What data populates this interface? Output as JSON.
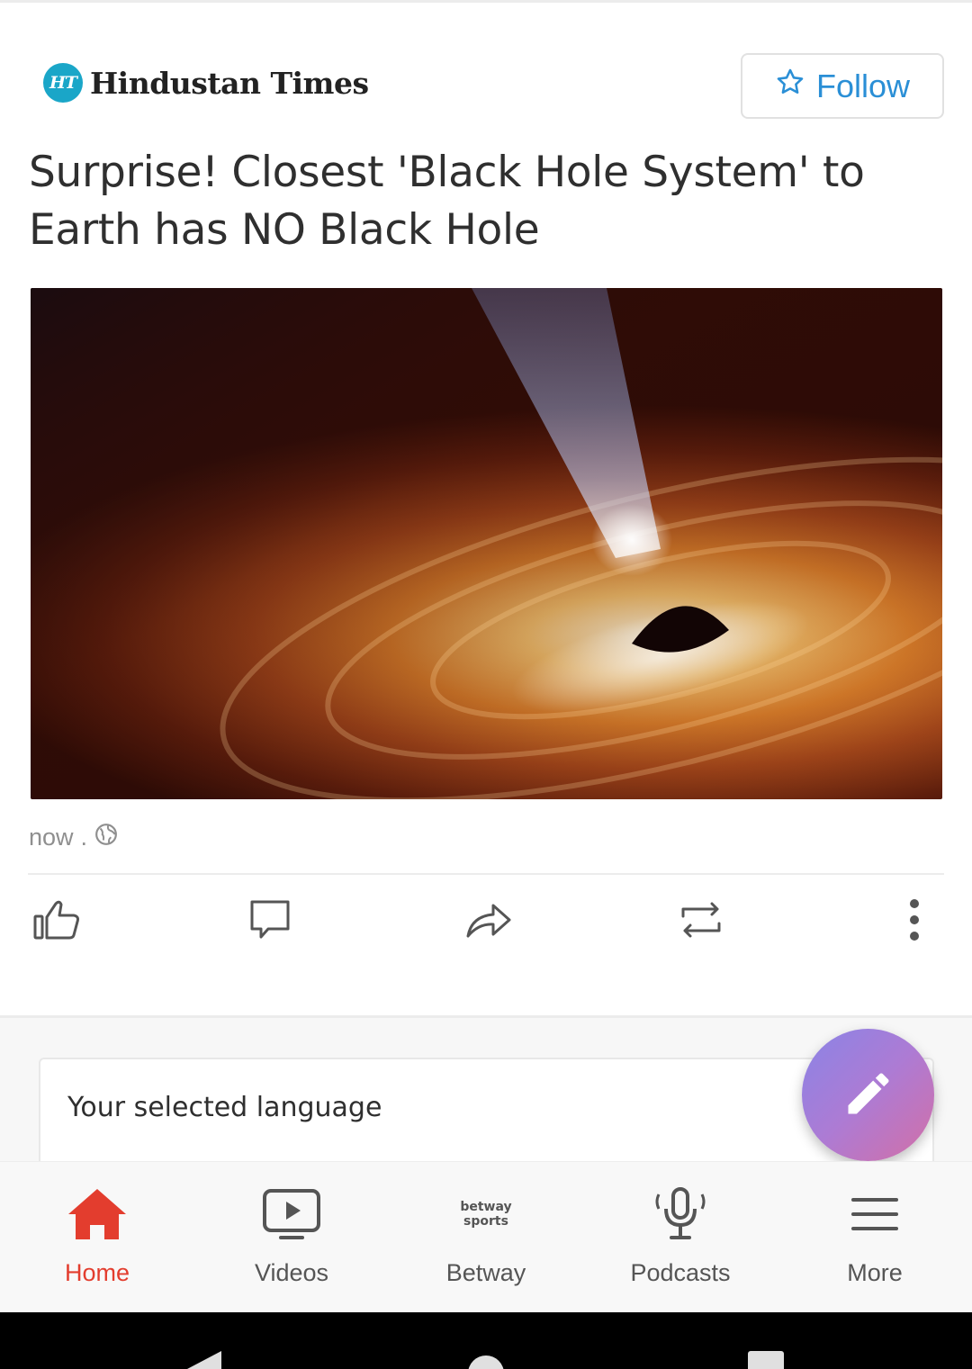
{
  "publisher": {
    "badge": "HT",
    "name": "Hindustan Times",
    "follow_label": "Follow"
  },
  "article": {
    "title": "Surprise! Closest 'Black Hole System' to Earth has NO Black Hole",
    "time": "now",
    "separator": ".",
    "visibility_icon": "globe-icon"
  },
  "actions": [
    {
      "name": "like",
      "icon": "thumbs-up-icon"
    },
    {
      "name": "comment",
      "icon": "comment-icon"
    },
    {
      "name": "share",
      "icon": "share-icon"
    },
    {
      "name": "repost",
      "icon": "repost-icon"
    },
    {
      "name": "more",
      "icon": "more-vertical-icon"
    }
  ],
  "language_card": {
    "label": "Your selected language"
  },
  "fab": {
    "icon": "pencil-icon"
  },
  "bottom_nav": {
    "items": [
      {
        "label": "Home",
        "icon": "home-icon",
        "active": true
      },
      {
        "label": "Videos",
        "icon": "video-icon",
        "active": false
      },
      {
        "label": "Betway",
        "icon": "betway-sports-logo",
        "logo_text": "betway sports",
        "active": false
      },
      {
        "label": "Podcasts",
        "icon": "microphone-icon",
        "active": false
      },
      {
        "label": "More",
        "icon": "menu-icon",
        "active": false
      }
    ]
  },
  "colors": {
    "accent_blue": "#2a8fd6",
    "active_red": "#e33d2e",
    "icon_gray": "#555555"
  }
}
